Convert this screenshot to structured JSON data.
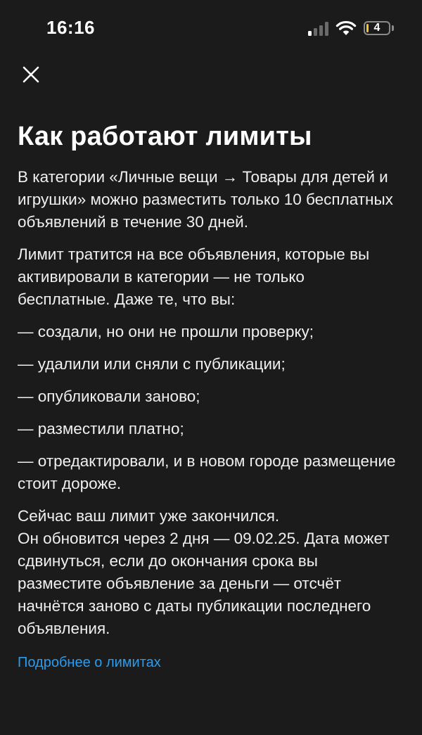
{
  "status_bar": {
    "time": "16:16",
    "battery_level": "4",
    "signal_bars_active": 1,
    "signal_bars_total": 4,
    "icons": [
      "signal-icon",
      "wifi-icon",
      "battery-icon"
    ]
  },
  "header": {
    "close_icon": "close-icon"
  },
  "content": {
    "title": "Как работают лимиты",
    "paragraph1": "В категории «Личные вещи → Товары для детей и игрушки» можно разместить только 10 бесплатных объявлений в течение 30 дней.",
    "paragraph2": "Лимит тратится на все объявления, которые вы активировали в категории — не только бесплатные. Даже те, что вы:",
    "list_items": [
      "— создали, но они не прошли проверку;",
      "— удалили или сняли с публикации;",
      "— опубликовали заново;",
      "— разместили платно;",
      "— отредактировали, и в новом городе размещение стоит дороже."
    ],
    "paragraph3_line1": "Сейчас ваш лимит уже закончился.",
    "paragraph3_line2": "Он обновится через 2 дня — 09.02.25. Дата может сдвинуться, если до окончания срока вы разместите объявление за деньги — отсчёт начнётся заново с даты публикации последнего объявления.",
    "link": "Подробнее о лимитах"
  },
  "colors": {
    "background": "#1b1b1b",
    "text": "#f0f0f0",
    "link": "#2a9cf0",
    "battery_fill": "#f4c530"
  }
}
